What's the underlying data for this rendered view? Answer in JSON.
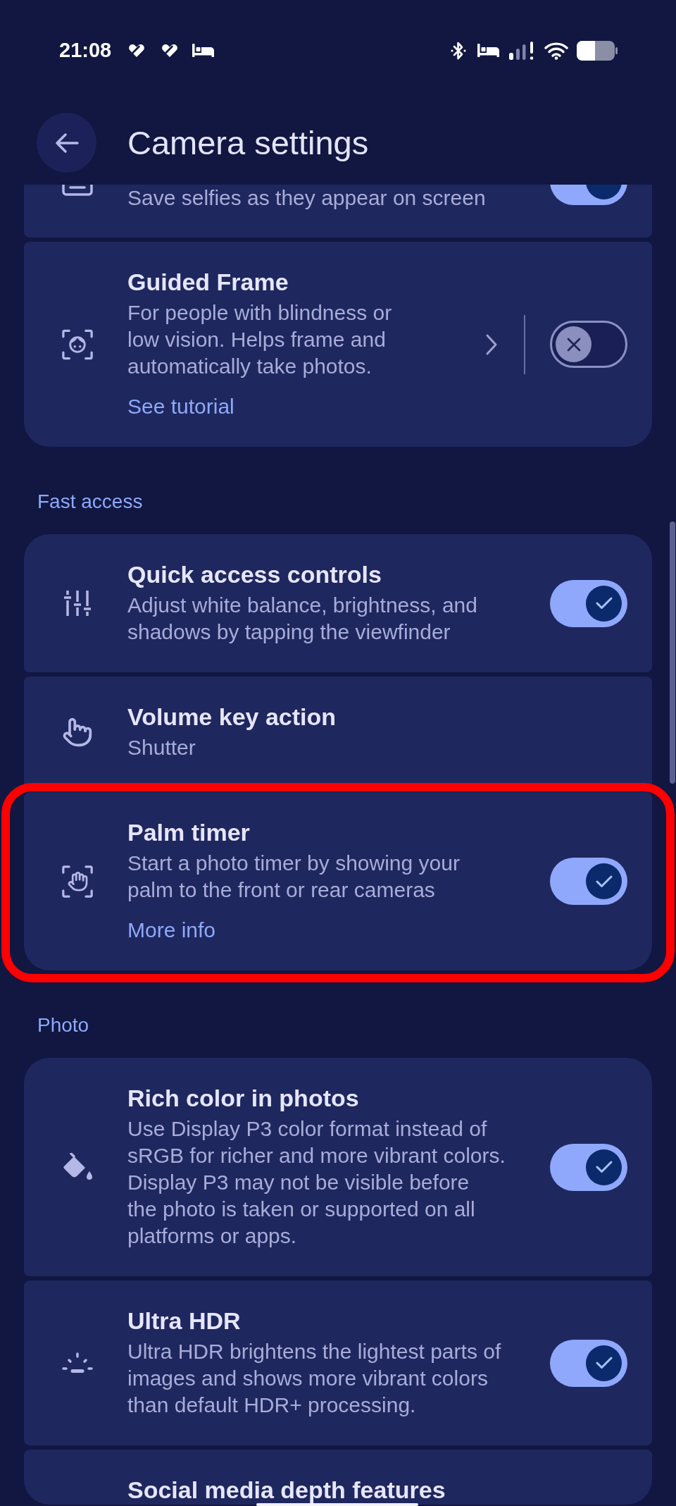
{
  "status_bar": {
    "time": "21:08"
  },
  "header": {
    "title": "Camera settings"
  },
  "sections": [
    {
      "items": [
        {
          "kind": "toggle",
          "description": "Save selfies as they appear on screen",
          "on": true,
          "highlighted": false
        },
        {
          "kind": "split_toggle",
          "title": "Guided Frame",
          "description": "For people with blindness or\nlow vision. Helps frame and\nautomatically take photos.",
          "link": "See tutorial",
          "on": false,
          "highlighted": false
        }
      ]
    },
    {
      "heading": "Fast access",
      "items": [
        {
          "kind": "toggle",
          "title": "Quick access controls",
          "description": "Adjust white balance, brightness, and\nshadows by tapping the viewfinder",
          "on": true,
          "highlighted": false
        },
        {
          "kind": "navigation",
          "title": "Volume key action",
          "description": "Shutter",
          "highlighted": false
        },
        {
          "kind": "toggle",
          "title": "Palm timer",
          "description": "Start a photo timer by showing your\npalm to the front or rear cameras",
          "link": "More info",
          "on": true,
          "highlighted": true
        }
      ]
    },
    {
      "heading": "Photo",
      "items": [
        {
          "kind": "toggle",
          "title": "Rich color in photos",
          "description": "Use Display P3 color format instead of\nsRGB for richer and more vibrant colors.\nDisplay P3 may not be visible before\nthe photo is taken or supported on all\nplatforms or apps.",
          "on": true,
          "highlighted": false
        },
        {
          "kind": "toggle",
          "title": "Ultra HDR",
          "description": "Ultra HDR brightens the lightest parts of\nimages and shows more vibrant colors\nthan default HDR+ processing.",
          "on": true,
          "highlighted": false
        },
        {
          "title": "Social media depth features",
          "highlighted": false
        }
      ]
    }
  ]
}
